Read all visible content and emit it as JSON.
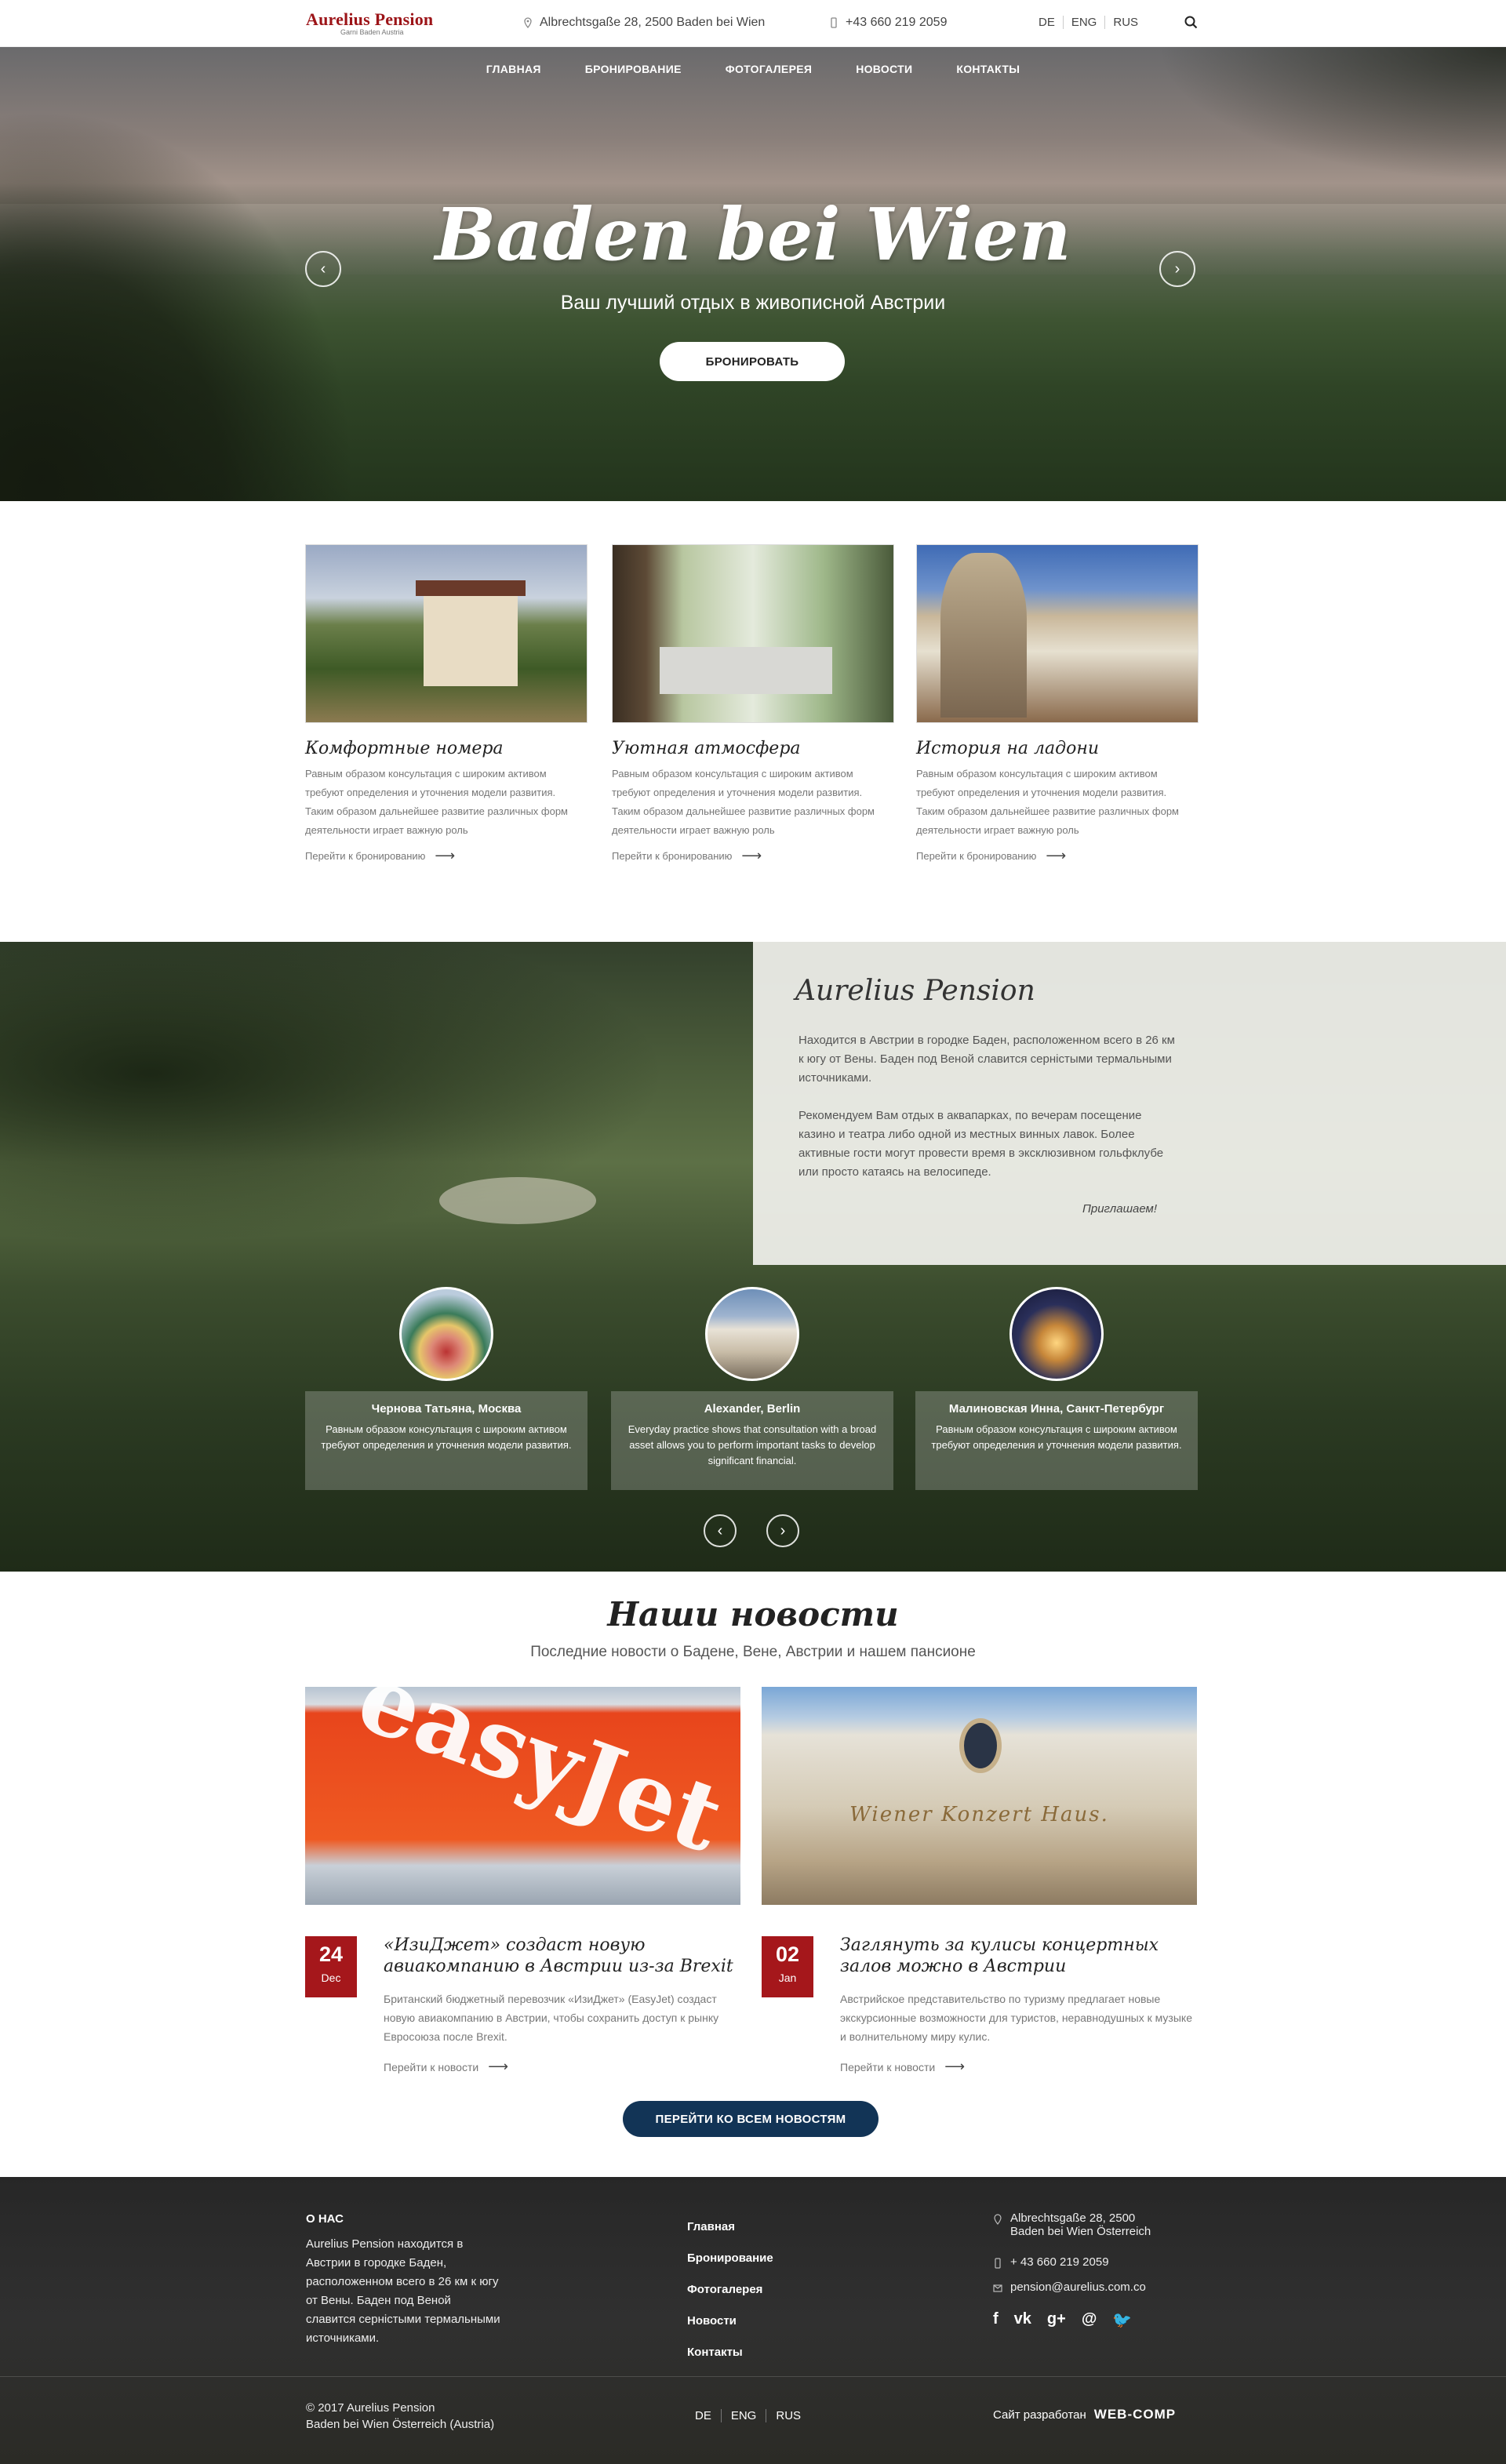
{
  "header": {
    "logo_title": "Aurelius Pension",
    "logo_subtitle": "Garni Baden Austria",
    "address": "Albrechtsgaße 28, 2500 Baden bei Wien",
    "phone": "+43 660 219 2059",
    "languages": [
      "DE",
      "ENG",
      "RUS"
    ],
    "search_icon": "search-icon"
  },
  "nav": {
    "items": [
      "ГЛАВНАЯ",
      "БРОНИРОВАНИЕ",
      "ФОТОГАЛЕРЕЯ",
      "НОВОСТИ",
      "КОНТАКТЫ"
    ]
  },
  "hero": {
    "title": "Baden bei Wien",
    "subtitle": "Ваш лучший отдых в живописной Австрии",
    "button": "БРОНИРОВАТЬ"
  },
  "features": [
    {
      "title": "Комфортные номера",
      "text": "Равным образом консультация с широким активом требуют определения и уточнения модели развития. Таким образом дальнейшее развитие различных форм деятельности играет важную роль",
      "link": "Перейти к бронированию"
    },
    {
      "title": "Уютная атмосфера",
      "text": "Равным образом консультация с широким активом требуют определения и уточнения модели развития. Таким образом дальнейшее развитие различных форм деятельности играет важную роль",
      "link": "Перейти к бронированию"
    },
    {
      "title": "История на ладони",
      "text": "Равным образом консультация с широким активом требуют определения и уточнения модели развития. Таким образом дальнейшее развитие различных форм деятельности играет важную роль",
      "link": "Перейти к бронированию"
    }
  ],
  "about": {
    "title": "Aurelius Pension",
    "p1": "Находится в Австрии в городке Баден, расположенном всего в 26 км к югу от Вены. Баден под Веной славится серністыми термальными источниками.",
    "p2": "Рекомендуем Вам отдых в аквапарках, по вечерам посещение казино и театра либо одной из местных винных лавок. Более активные гости могут провести время в эксклюзивном гольфклубе или просто катаясь на велосипеде.",
    "sign": "Приглашаем!"
  },
  "reviews": [
    {
      "name": "Чернова Татьяна, Москва",
      "text": "Равным образом консультация с широким активом требуют определения и уточнения модели развития."
    },
    {
      "name": "Alexander, Berlin",
      "text": "Everyday practice shows that consultation with a broad asset allows you to perform important tasks to develop significant financial."
    },
    {
      "name": "Малиновская Инна, Санкт-Петербург",
      "text": "Равным образом консультация с широким активом требуют определения и уточнения модели развития."
    }
  ],
  "news": {
    "title": "Наши новости",
    "subtitle": "Последние новости о Бадене, Вене, Австрии и нашем пансионе",
    "items": [
      {
        "day": "24",
        "month": "Dec",
        "title": "«ИзиДжет» создаст новую авиакомпанию в Австрии из-за Brexit",
        "text": "Британский бюджетный перевозчик «ИзиДжет» (EasyJet) создаст новую авиакомпанию в Австрии, чтобы сохранить доступ к рынку Евросоюза после Brexit.",
        "link": "Перейти к новости",
        "image_text": "easyJet"
      },
      {
        "day": "02",
        "month": "Jan",
        "title": "Заглянуть за кулисы концертных залов можно в Австрии",
        "text": "Австрийское представительство по туризму предлагает новые экскурсионные возможности для туристов, неравнодушных к музыке и волнительному миру кулис.",
        "link": "Перейти к новости",
        "image_text": "Wiener Konzert Haus."
      }
    ],
    "all_button": "ПЕРЕЙТИ КО ВСЕМ НОВОСТЯМ"
  },
  "footer": {
    "about_title": "О НАС",
    "about_text": "Aurelius Pension находится в Австрии в городке Баден, расположенном всего в 26 км к югу от Вены. Баден под Веной славится серністыми термальными источниками.",
    "links": [
      "Главная",
      "Бронирование",
      "Фотогалерея",
      "Новости",
      "Контакты"
    ],
    "address_line1": "Albrechtsgaße 28, 2500",
    "address_line2": "Baden bei Wien Österreich",
    "phone": "+ 43 660 219 2059",
    "email": "pension@aurelius.com.co",
    "social": [
      "f",
      "vk",
      "g+",
      "@",
      "twitter"
    ],
    "copyright_line1": "© 2017  Aurelius Pension",
    "copyright_line2": "Baden bei Wien Österreich (Austria)",
    "languages": [
      "DE",
      "ENG",
      "RUS"
    ],
    "dev_label": "Сайт разработан",
    "dev_name": "WEB-COMP"
  }
}
